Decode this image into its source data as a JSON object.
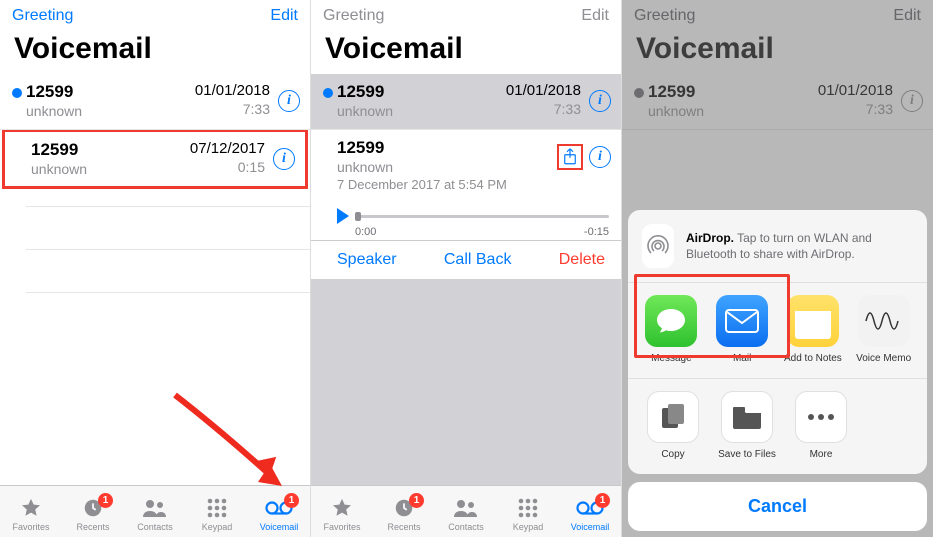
{
  "common": {
    "greeting": "Greeting",
    "edit": "Edit",
    "title": "Voicemail",
    "tabs": {
      "favorites": "Favorites",
      "recents": "Recents",
      "contacts": "Contacts",
      "keypad": "Keypad",
      "voicemail": "Voicemail",
      "recents_badge": "1",
      "voicemail_badge": "1"
    }
  },
  "screen1": {
    "rows": [
      {
        "number": "12599",
        "sub": "unknown",
        "date": "01/01/2018",
        "dur": "7:33",
        "unread": true
      },
      {
        "number": "12599",
        "sub": "unknown",
        "date": "07/12/2017",
        "dur": "0:15",
        "unread": false
      }
    ]
  },
  "screen2": {
    "rows": [
      {
        "number": "12599",
        "sub": "unknown",
        "date": "01/01/2018",
        "dur": "7:33",
        "unread": true
      }
    ],
    "expanded": {
      "number": "12599",
      "sub": "unknown",
      "detail": "7 December 2017 at 5:54 PM",
      "t_start": "0:00",
      "t_end": "-0:15",
      "speaker": "Speaker",
      "callback": "Call Back",
      "delete": "Delete"
    }
  },
  "screen3": {
    "rows": [
      {
        "number": "12599",
        "sub": "unknown",
        "date": "01/01/2018",
        "dur": "7:33"
      }
    ],
    "sheet": {
      "airdrop_bold": "AirDrop.",
      "airdrop_text": " Tap to turn on WLAN and Bluetooth to share with AirDrop.",
      "apps": [
        {
          "key": "message",
          "label": "Message"
        },
        {
          "key": "mail",
          "label": "Mail"
        },
        {
          "key": "notes",
          "label": "Add to Notes"
        },
        {
          "key": "vmemo",
          "label": "Voice Memo"
        }
      ],
      "actions": [
        {
          "key": "copy",
          "label": "Copy"
        },
        {
          "key": "save",
          "label": "Save to Files"
        },
        {
          "key": "more",
          "label": "More"
        }
      ],
      "cancel": "Cancel"
    }
  }
}
